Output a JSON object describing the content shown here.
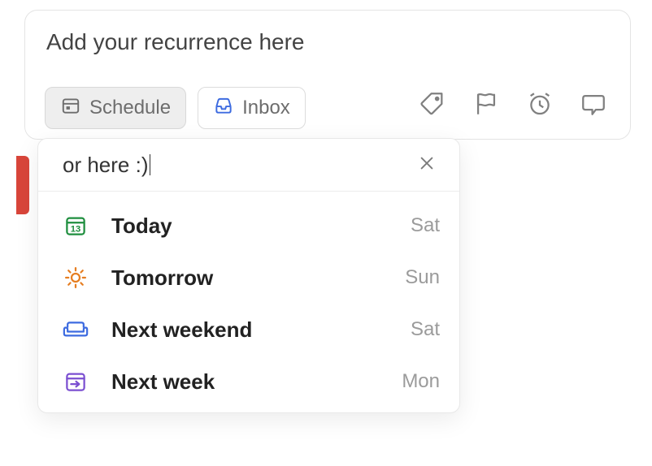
{
  "composer": {
    "task_placeholder": "Add your recurrence here",
    "task_value": "Add your recurrence here",
    "schedule_label": "Schedule",
    "inbox_label": "Inbox"
  },
  "scheduler": {
    "search_value": "or here :)",
    "options": [
      {
        "label": "Today",
        "day": "Sat",
        "icon": "calendar-today",
        "color": "#1e8e3e",
        "badge": "13"
      },
      {
        "label": "Tomorrow",
        "day": "Sun",
        "icon": "sun",
        "color": "#e67e22"
      },
      {
        "label": "Next weekend",
        "day": "Sat",
        "icon": "couch",
        "color": "#3d6be0"
      },
      {
        "label": "Next week",
        "day": "Mon",
        "icon": "calendar-arrow",
        "color": "#7b4fd1"
      }
    ]
  },
  "icons": {
    "schedule": "calendar-icon",
    "inbox": "inbox-icon",
    "tag": "tag-icon",
    "flag": "flag-icon",
    "alarm": "alarm-icon",
    "comment": "comment-icon",
    "close": "close-icon"
  },
  "colors": {
    "inbox_accent": "#3d6be0",
    "red_peek": "#d8453a",
    "muted": "#808080"
  }
}
